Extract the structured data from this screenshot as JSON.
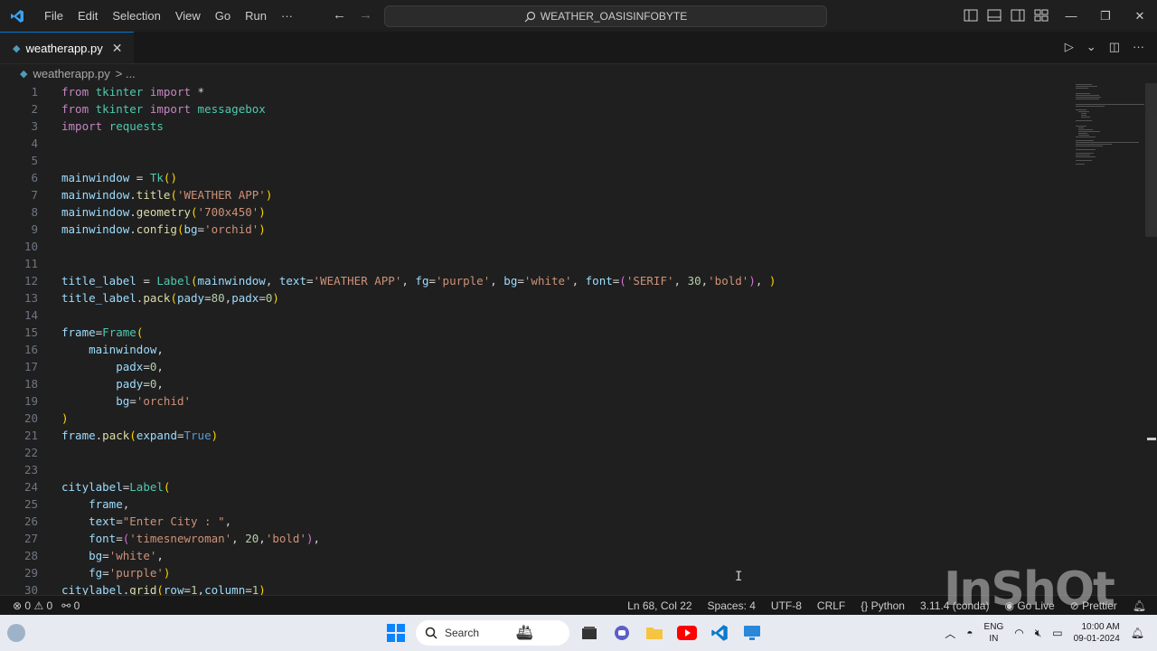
{
  "menu": [
    "File",
    "Edit",
    "Selection",
    "View",
    "Go",
    "Run",
    "···"
  ],
  "command_center": "WEATHER_OASISINFOBYTE",
  "tab": {
    "label": "weatherapp.py",
    "close": "✕"
  },
  "breadcrumb": {
    "file": "weatherapp.py",
    "more": "> ..."
  },
  "line_numbers": [
    "1",
    "2",
    "3",
    "4",
    "5",
    "6",
    "7",
    "8",
    "9",
    "10",
    "11",
    "12",
    "13",
    "14",
    "15",
    "16",
    "17",
    "18",
    "19",
    "20",
    "21",
    "22",
    "23",
    "24",
    "25",
    "26",
    "27",
    "28",
    "29",
    "30"
  ],
  "code": [
    [
      [
        "kw",
        "from "
      ],
      [
        "cls",
        "tkinter "
      ],
      [
        "kw",
        "import "
      ],
      [
        "op",
        "*"
      ]
    ],
    [
      [
        "kw",
        "from "
      ],
      [
        "cls",
        "tkinter "
      ],
      [
        "kw",
        "import "
      ],
      [
        "cls",
        "messagebox"
      ]
    ],
    [
      [
        "kw",
        "import "
      ],
      [
        "cls",
        "requests"
      ]
    ],
    [],
    [],
    [
      [
        "var",
        "mainwindow "
      ],
      [
        "op",
        "= "
      ],
      [
        "cls",
        "Tk"
      ],
      [
        "br1",
        "()"
      ]
    ],
    [
      [
        "var",
        "mainwindow"
      ],
      [
        "op",
        "."
      ],
      [
        "fn",
        "title"
      ],
      [
        "br1",
        "("
      ],
      [
        "str",
        "'WEATHER APP'"
      ],
      [
        "br1",
        ")"
      ]
    ],
    [
      [
        "var",
        "mainwindow"
      ],
      [
        "op",
        "."
      ],
      [
        "fn",
        "geometry"
      ],
      [
        "br1",
        "("
      ],
      [
        "str",
        "'700x450'"
      ],
      [
        "br1",
        ")"
      ]
    ],
    [
      [
        "var",
        "mainwindow"
      ],
      [
        "op",
        "."
      ],
      [
        "fn",
        "config"
      ],
      [
        "br1",
        "("
      ],
      [
        "var",
        "bg"
      ],
      [
        "op",
        "="
      ],
      [
        "str",
        "'orchid'"
      ],
      [
        "br1",
        ")"
      ]
    ],
    [],
    [],
    [
      [
        "var",
        "title_label "
      ],
      [
        "op",
        "= "
      ],
      [
        "cls",
        "Label"
      ],
      [
        "br1",
        "("
      ],
      [
        "var",
        "mainwindow"
      ],
      [
        "op",
        ", "
      ],
      [
        "var",
        "text"
      ],
      [
        "op",
        "="
      ],
      [
        "str",
        "'WEATHER APP'"
      ],
      [
        "op",
        ", "
      ],
      [
        "var",
        "fg"
      ],
      [
        "op",
        "="
      ],
      [
        "str",
        "'purple'"
      ],
      [
        "op",
        ", "
      ],
      [
        "var",
        "bg"
      ],
      [
        "op",
        "="
      ],
      [
        "str",
        "'white'"
      ],
      [
        "op",
        ", "
      ],
      [
        "var",
        "font"
      ],
      [
        "op",
        "="
      ],
      [
        "br2",
        "("
      ],
      [
        "str",
        "'SERIF'"
      ],
      [
        "op",
        ", "
      ],
      [
        "num",
        "30"
      ],
      [
        "op",
        ","
      ],
      [
        "str",
        "'bold'"
      ],
      [
        "br2",
        ")"
      ],
      [
        "op",
        ", "
      ],
      [
        "br1",
        ")"
      ]
    ],
    [
      [
        "var",
        "title_label"
      ],
      [
        "op",
        "."
      ],
      [
        "fn",
        "pack"
      ],
      [
        "br1",
        "("
      ],
      [
        "var",
        "pady"
      ],
      [
        "op",
        "="
      ],
      [
        "num",
        "80"
      ],
      [
        "op",
        ","
      ],
      [
        "var",
        "padx"
      ],
      [
        "op",
        "="
      ],
      [
        "num",
        "0"
      ],
      [
        "br1",
        ")"
      ]
    ],
    [],
    [
      [
        "var",
        "frame"
      ],
      [
        "op",
        "="
      ],
      [
        "cls",
        "Frame"
      ],
      [
        "br1",
        "("
      ]
    ],
    [
      [
        "op",
        "    "
      ],
      [
        "var",
        "mainwindow"
      ],
      [
        "op",
        ","
      ]
    ],
    [
      [
        "op",
        "        "
      ],
      [
        "var",
        "padx"
      ],
      [
        "op",
        "="
      ],
      [
        "num",
        "0"
      ],
      [
        "op",
        ","
      ]
    ],
    [
      [
        "op",
        "        "
      ],
      [
        "var",
        "pady"
      ],
      [
        "op",
        "="
      ],
      [
        "num",
        "0"
      ],
      [
        "op",
        ","
      ]
    ],
    [
      [
        "op",
        "        "
      ],
      [
        "var",
        "bg"
      ],
      [
        "op",
        "="
      ],
      [
        "str",
        "'orchid'"
      ]
    ],
    [
      [
        "br1",
        ")"
      ]
    ],
    [
      [
        "var",
        "frame"
      ],
      [
        "op",
        "."
      ],
      [
        "fn",
        "pack"
      ],
      [
        "br1",
        "("
      ],
      [
        "var",
        "expand"
      ],
      [
        "op",
        "="
      ],
      [
        "bool",
        "True"
      ],
      [
        "br1",
        ")"
      ]
    ],
    [],
    [],
    [
      [
        "var",
        "citylabel"
      ],
      [
        "op",
        "="
      ],
      [
        "cls",
        "Label"
      ],
      [
        "br1",
        "("
      ]
    ],
    [
      [
        "op",
        "    "
      ],
      [
        "var",
        "frame"
      ],
      [
        "op",
        ","
      ]
    ],
    [
      [
        "op",
        "    "
      ],
      [
        "var",
        "text"
      ],
      [
        "op",
        "="
      ],
      [
        "str",
        "\"Enter City : \""
      ],
      [
        "op",
        ","
      ]
    ],
    [
      [
        "op",
        "    "
      ],
      [
        "var",
        "font"
      ],
      [
        "op",
        "="
      ],
      [
        "br2",
        "("
      ],
      [
        "str",
        "'timesnewroman'"
      ],
      [
        "op",
        ", "
      ],
      [
        "num",
        "20"
      ],
      [
        "op",
        ","
      ],
      [
        "str",
        "'bold'"
      ],
      [
        "br2",
        ")"
      ],
      [
        "op",
        ","
      ]
    ],
    [
      [
        "op",
        "    "
      ],
      [
        "var",
        "bg"
      ],
      [
        "op",
        "="
      ],
      [
        "str",
        "'white'"
      ],
      [
        "op",
        ","
      ]
    ],
    [
      [
        "op",
        "    "
      ],
      [
        "var",
        "fg"
      ],
      [
        "op",
        "="
      ],
      [
        "str",
        "'purple'"
      ],
      [
        "br1",
        ")"
      ]
    ],
    [
      [
        "var",
        "citylabel"
      ],
      [
        "op",
        "."
      ],
      [
        "fn",
        "grid"
      ],
      [
        "br1",
        "("
      ],
      [
        "var",
        "row"
      ],
      [
        "op",
        "="
      ],
      [
        "num",
        "1"
      ],
      [
        "op",
        ","
      ],
      [
        "var",
        "column"
      ],
      [
        "op",
        "="
      ],
      [
        "num",
        "1"
      ],
      [
        "br1",
        ")"
      ]
    ]
  ],
  "status": {
    "errors": "0",
    "warnings": "0",
    "ports": "0",
    "position": "Ln 68, Col 22",
    "spaces": "Spaces: 4",
    "encoding": "UTF-8",
    "eol": "CRLF",
    "language": "Python",
    "interpreter": "3.11.4 (conda)",
    "golive": "Go Live",
    "prettier": "Prettier"
  },
  "taskbar": {
    "search_placeholder": "Search",
    "lang_1": "ENG",
    "lang_2": "IN",
    "time": "10:00 AM",
    "date": "09-01-2024"
  },
  "watermark": "InShOt",
  "colors": {
    "accent": "#0078d4",
    "editor_bg": "#1f1f1f",
    "taskbar_bg": "#e8eaf2"
  }
}
